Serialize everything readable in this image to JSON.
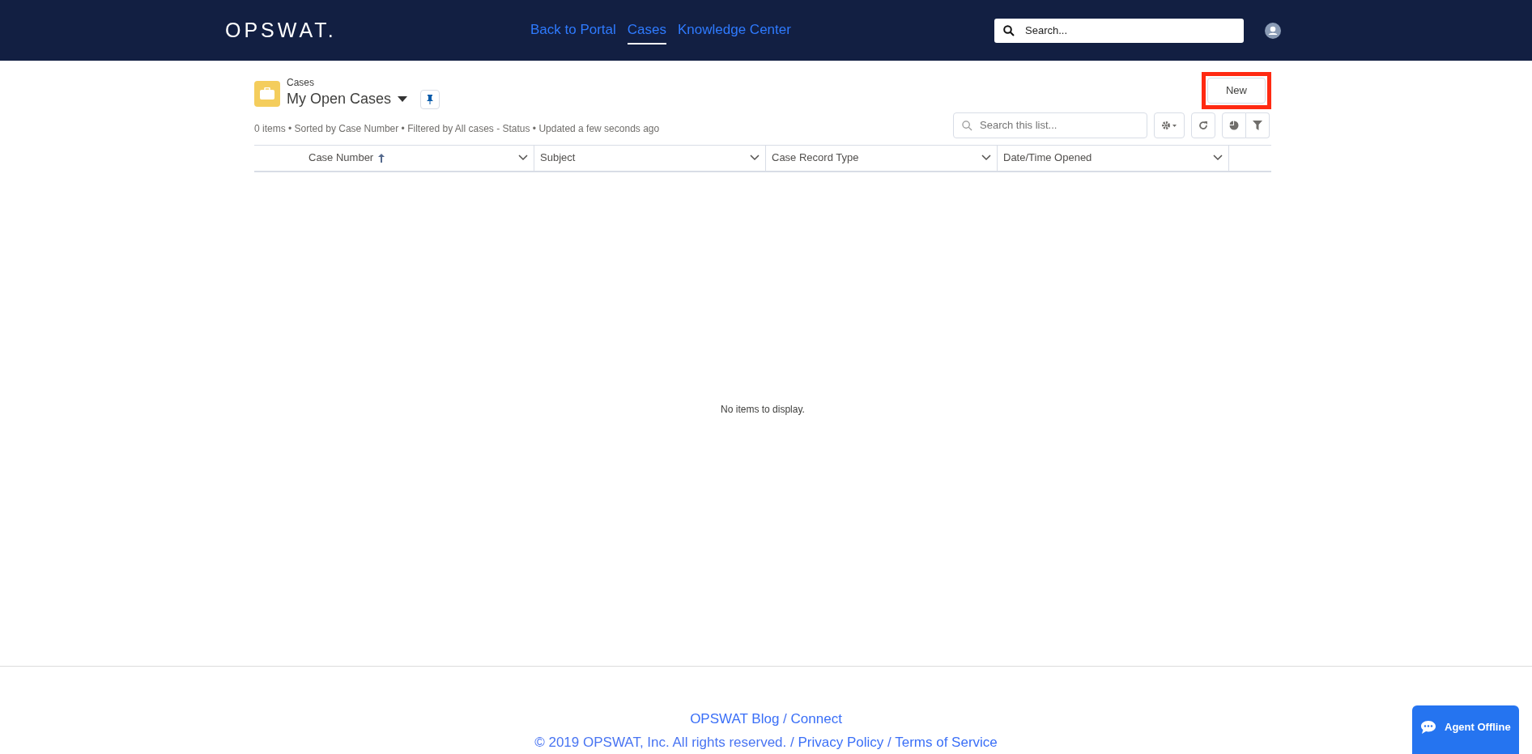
{
  "header": {
    "logo": "OPSWAT.",
    "nav": [
      {
        "label": "Back to Portal",
        "selected": false
      },
      {
        "label": "Cases",
        "selected": true
      },
      {
        "label": "Knowledge Center",
        "selected": false
      }
    ],
    "search": {
      "placeholder": "Search..."
    }
  },
  "list_view": {
    "object": "Cases",
    "title": "My Open Cases",
    "status": "0 items • Sorted by Case Number • Filtered by All cases - Status • Updated a few seconds ago",
    "new_button": {
      "label": "New",
      "highlighted": true
    },
    "search": {
      "placeholder": "Search this list..."
    },
    "columns": [
      {
        "label": "Case Number",
        "sorted": true
      },
      {
        "label": "Subject",
        "sorted": false
      },
      {
        "label": "Case Record Type",
        "sorted": false
      },
      {
        "label": "Date/Time Opened",
        "sorted": false
      }
    ],
    "empty_message": "No items to display."
  },
  "footer": {
    "line_1": [
      {
        "kind": "link",
        "text": "OPSWAT Blog"
      },
      {
        "kind": "text",
        "text": "/"
      },
      {
        "kind": "link",
        "text": "Connect"
      }
    ],
    "line_2": [
      {
        "kind": "text",
        "text": "© 2019 OPSWAT, Inc. All rights reserved."
      },
      {
        "kind": "text",
        "text": "/"
      },
      {
        "kind": "link",
        "text": "Privacy Policy"
      },
      {
        "kind": "text",
        "text": "/"
      },
      {
        "kind": "link",
        "text": "Terms of Service"
      }
    ]
  },
  "chat_button": {
    "label": "Agent Offline"
  }
}
